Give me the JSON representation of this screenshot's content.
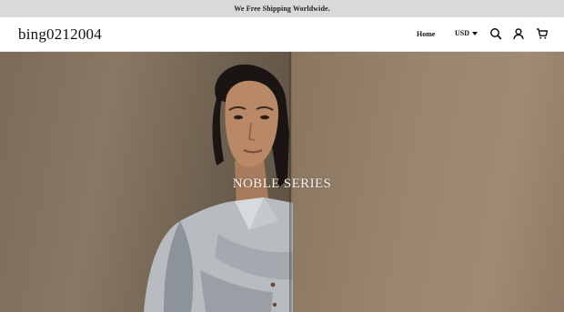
{
  "announcement": "We Free Shipping Worldwide.",
  "header": {
    "logo": "bing0212004",
    "nav": {
      "home_label": "Home"
    },
    "currency": {
      "selected": "USD"
    },
    "icons": [
      "search-icon",
      "account-icon",
      "cart-icon"
    ]
  },
  "hero": {
    "title": "NOBLE SERIES"
  },
  "colors": {
    "announcement_bg": "#d9d9d9",
    "hero_title": "#f3efe9"
  }
}
